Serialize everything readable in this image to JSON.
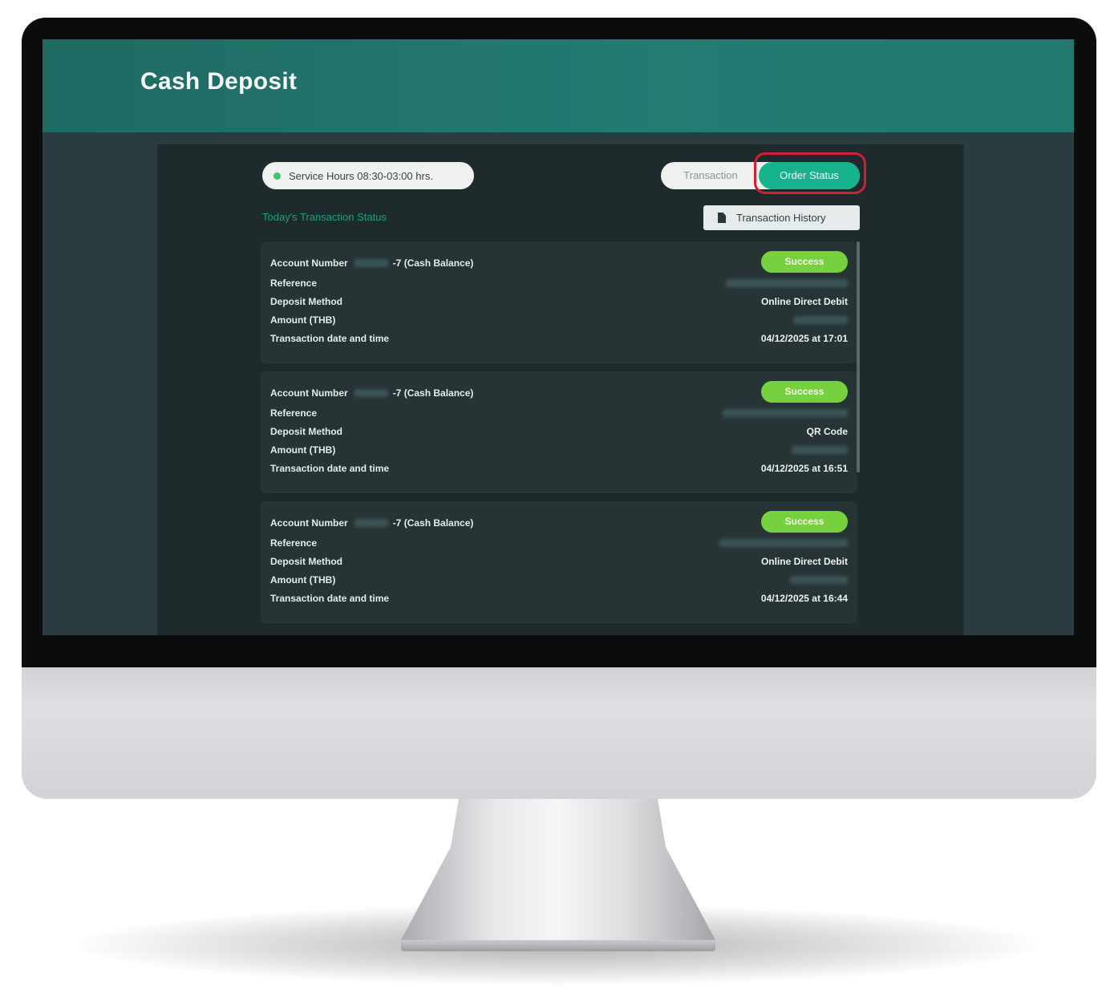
{
  "app": {
    "title": "Cash Deposit"
  },
  "service": {
    "hours_label": "Service Hours 08:30-03:00 hrs."
  },
  "tabs": [
    {
      "label": "Transaction",
      "active": false
    },
    {
      "label": "Order Status",
      "active": true
    }
  ],
  "section": {
    "title": "Today's Transaction Status"
  },
  "history_button": {
    "label": "Transaction History"
  },
  "labels": {
    "account_number": "Account Number",
    "reference": "Reference",
    "deposit_method": "Deposit Method",
    "amount": "Amount (THB)",
    "datetime": "Transaction date and time"
  },
  "transactions": [
    {
      "account_suffix": "-7 (Cash Balance)",
      "status": "Success",
      "deposit_method": "Online Direct Debit",
      "datetime": "04/12/2025 at 17:01"
    },
    {
      "account_suffix": "-7 (Cash Balance)",
      "status": "Success",
      "deposit_method": "QR Code",
      "datetime": "04/12/2025 at 16:51"
    },
    {
      "account_suffix": "-7 (Cash Balance)",
      "status": "Success",
      "deposit_method": "Online Direct Debit",
      "datetime": "04/12/2025 at 16:44"
    }
  ],
  "colors": {
    "header": "#237b72",
    "accent_tab": "#17b38c",
    "success_badge": "#77d13e",
    "highlight": "#d11f33"
  },
  "icons": {
    "service_status": "green-dot-icon",
    "history": "document-icon"
  }
}
